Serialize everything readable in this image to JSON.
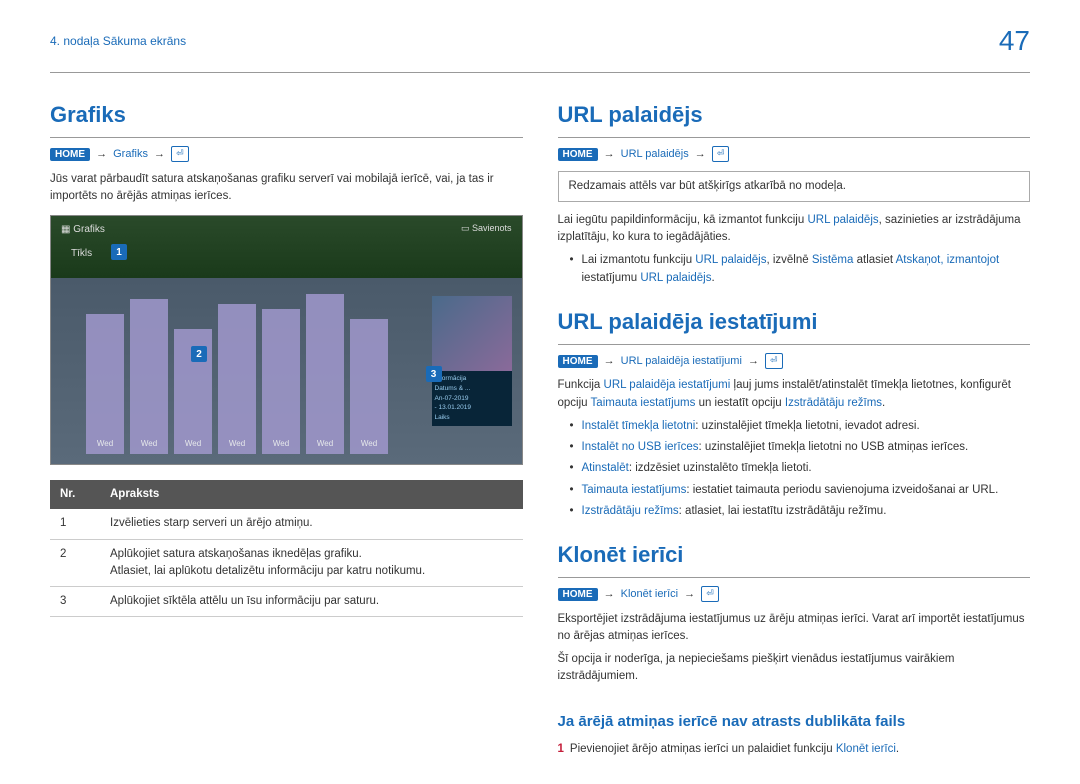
{
  "header": {
    "chapter": "4. nodaļa Sākuma ekrāns",
    "page_number": "47"
  },
  "left": {
    "title": "Grafiks",
    "crumb": {
      "home": "HOME",
      "link": "Grafiks"
    },
    "intro": "Jūs varat pārbaudīt satura atskaņošanas grafiku serverī vai mobilajā ierīcē, vai, ja tas ir importēts no ārējās atmiņas ierīces.",
    "screenshot": {
      "topbar_left": "Grafiks",
      "topbar_right": "▭ Savienots",
      "row2": "Tīkls",
      "callouts": {
        "c1": "1",
        "c2": "2",
        "c3": "3"
      },
      "bars": [
        "Wed",
        "Wed",
        "Wed",
        "Wed",
        "Wed",
        "Wed",
        "Wed"
      ],
      "panel": {
        "title": "Informācija",
        "l1": "Datums & ...",
        "l2": "An-07-2019",
        "l3": "- 13.01.2019",
        "l4": "Laiks"
      }
    },
    "table": {
      "head_nr": "Nr.",
      "head_desc": "Apraksts",
      "rows": [
        {
          "nr": "1",
          "text": "Izvēlieties starp serveri un ārējo atmiņu."
        },
        {
          "nr": "2",
          "text": "Aplūkojiet satura atskaņošanas iknedēļas grafiku.\nAtlasiet, lai aplūkotu detalizētu informāciju par katru notikumu."
        },
        {
          "nr": "3",
          "text": "Aplūkojiet sīktēla attēlu un īsu informāciju par saturu."
        }
      ]
    }
  },
  "right": {
    "s1": {
      "title": "URL palaidējs",
      "crumb": {
        "home": "HOME",
        "link": "URL palaidējs"
      },
      "note": "Redzamais attēls var būt atšķirīgs atkarībā no modeļa.",
      "p1_a": "Lai iegūtu papildinformāciju, kā izmantot funkciju ",
      "p1_link": "URL palaidējs",
      "p1_b": ", sazinieties ar izstrādājuma izplatītāju, ko kura to iegādājāties.",
      "bullet_a": "Lai izmantotu funkciju ",
      "bullet_link1": "URL palaidējs",
      "bullet_b": ", izvēlnē ",
      "bullet_link2": "Sistēma",
      "bullet_c": " atlasiet ",
      "bullet_link3": "Atskaņot, izmantojot",
      "bullet_d": " iestatījumu ",
      "bullet_link4": "URL palaidējs",
      "bullet_e": "."
    },
    "s2": {
      "title": "URL palaidēja iestatījumi",
      "crumb": {
        "home": "HOME",
        "link": "URL palaidēja iestatījumi"
      },
      "p_a": "Funkcija ",
      "p_link1": "URL palaidēja iestatījumi",
      "p_b": " ļauj jums instalēt/atinstalēt tīmekļa lietotnes, konfigurēt opciju ",
      "p_link2": "Taimauta iestatījums",
      "p_c": " un iestatīt opciju ",
      "p_link3": "Izstrādātāju režīms",
      "p_d": ".",
      "items": {
        "i1_l": "Instalēt tīmekļa lietotni",
        "i1_t": ": uzinstalējiet tīmekļa lietotni, ievadot adresi.",
        "i2_l": "Instalēt no USB ierīces",
        "i2_t": ": uzinstalējiet tīmekļa lietotni no USB atmiņas ierīces.",
        "i3_l": "Atinstalēt",
        "i3_t": ": izdzēsiet uzinstalēto tīmekļa lietoti.",
        "i4_l": "Taimauta iestatījums",
        "i4_t": ": iestatiet taimauta periodu savienojuma izveidošanai ar URL.",
        "i5_l": "Izstrādātāju režīms",
        "i5_t": ": atlasiet, lai iestatītu izstrādātāju režīmu."
      }
    },
    "s3": {
      "title": "Klonēt ierīci",
      "crumb": {
        "home": "HOME",
        "link": "Klonēt ierīci"
      },
      "p1": "Eksportējiet izstrādājuma iestatījumus uz ārēju atmiņas ierīci. Varat arī importēt iestatījumus no ārējas atmiņas ierīces.",
      "p2": "Šī opcija ir noderīga, ja nepieciešams piešķirt vienādus iestatījumus vairākiem izstrādājumiem.",
      "sub": "Ja ārējā atmiņas ierīcē nav atrasts dublikāta fails",
      "step_n": "1",
      "step_a": "Pievienojiet ārējo atmiņas ierīci un palaidiet funkciju ",
      "step_link": "Klonēt ierīci",
      "step_b": "."
    }
  }
}
